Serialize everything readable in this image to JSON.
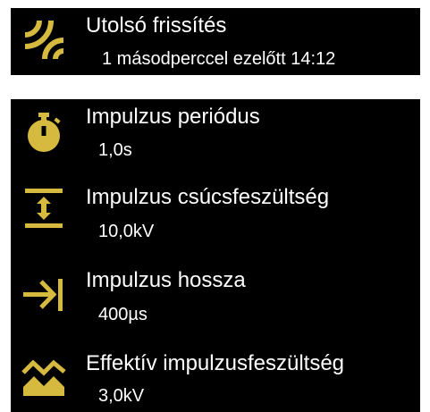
{
  "last_refresh": {
    "icon": "wireless-signal-icon",
    "title": "Utolsó frissítés",
    "value": "1 másodperccel ezelőtt 14:12"
  },
  "metrics": [
    {
      "icon": "stopwatch-icon",
      "title": "Impulzus periódus",
      "value": "1,0s"
    },
    {
      "icon": "peak-voltage-icon",
      "title": "Impulzus csúcsfeszültség",
      "value": "10,0kV"
    },
    {
      "icon": "arrow-to-bar-icon",
      "title": "Impulzus hossza",
      "value": "400µs"
    },
    {
      "icon": "waveform-icon",
      "title": "Effektív impulzusfeszültség",
      "value": "3,0kV"
    }
  ],
  "colors": {
    "accent": "#d6b93f",
    "background": "#000000",
    "text": "#ffffff"
  }
}
